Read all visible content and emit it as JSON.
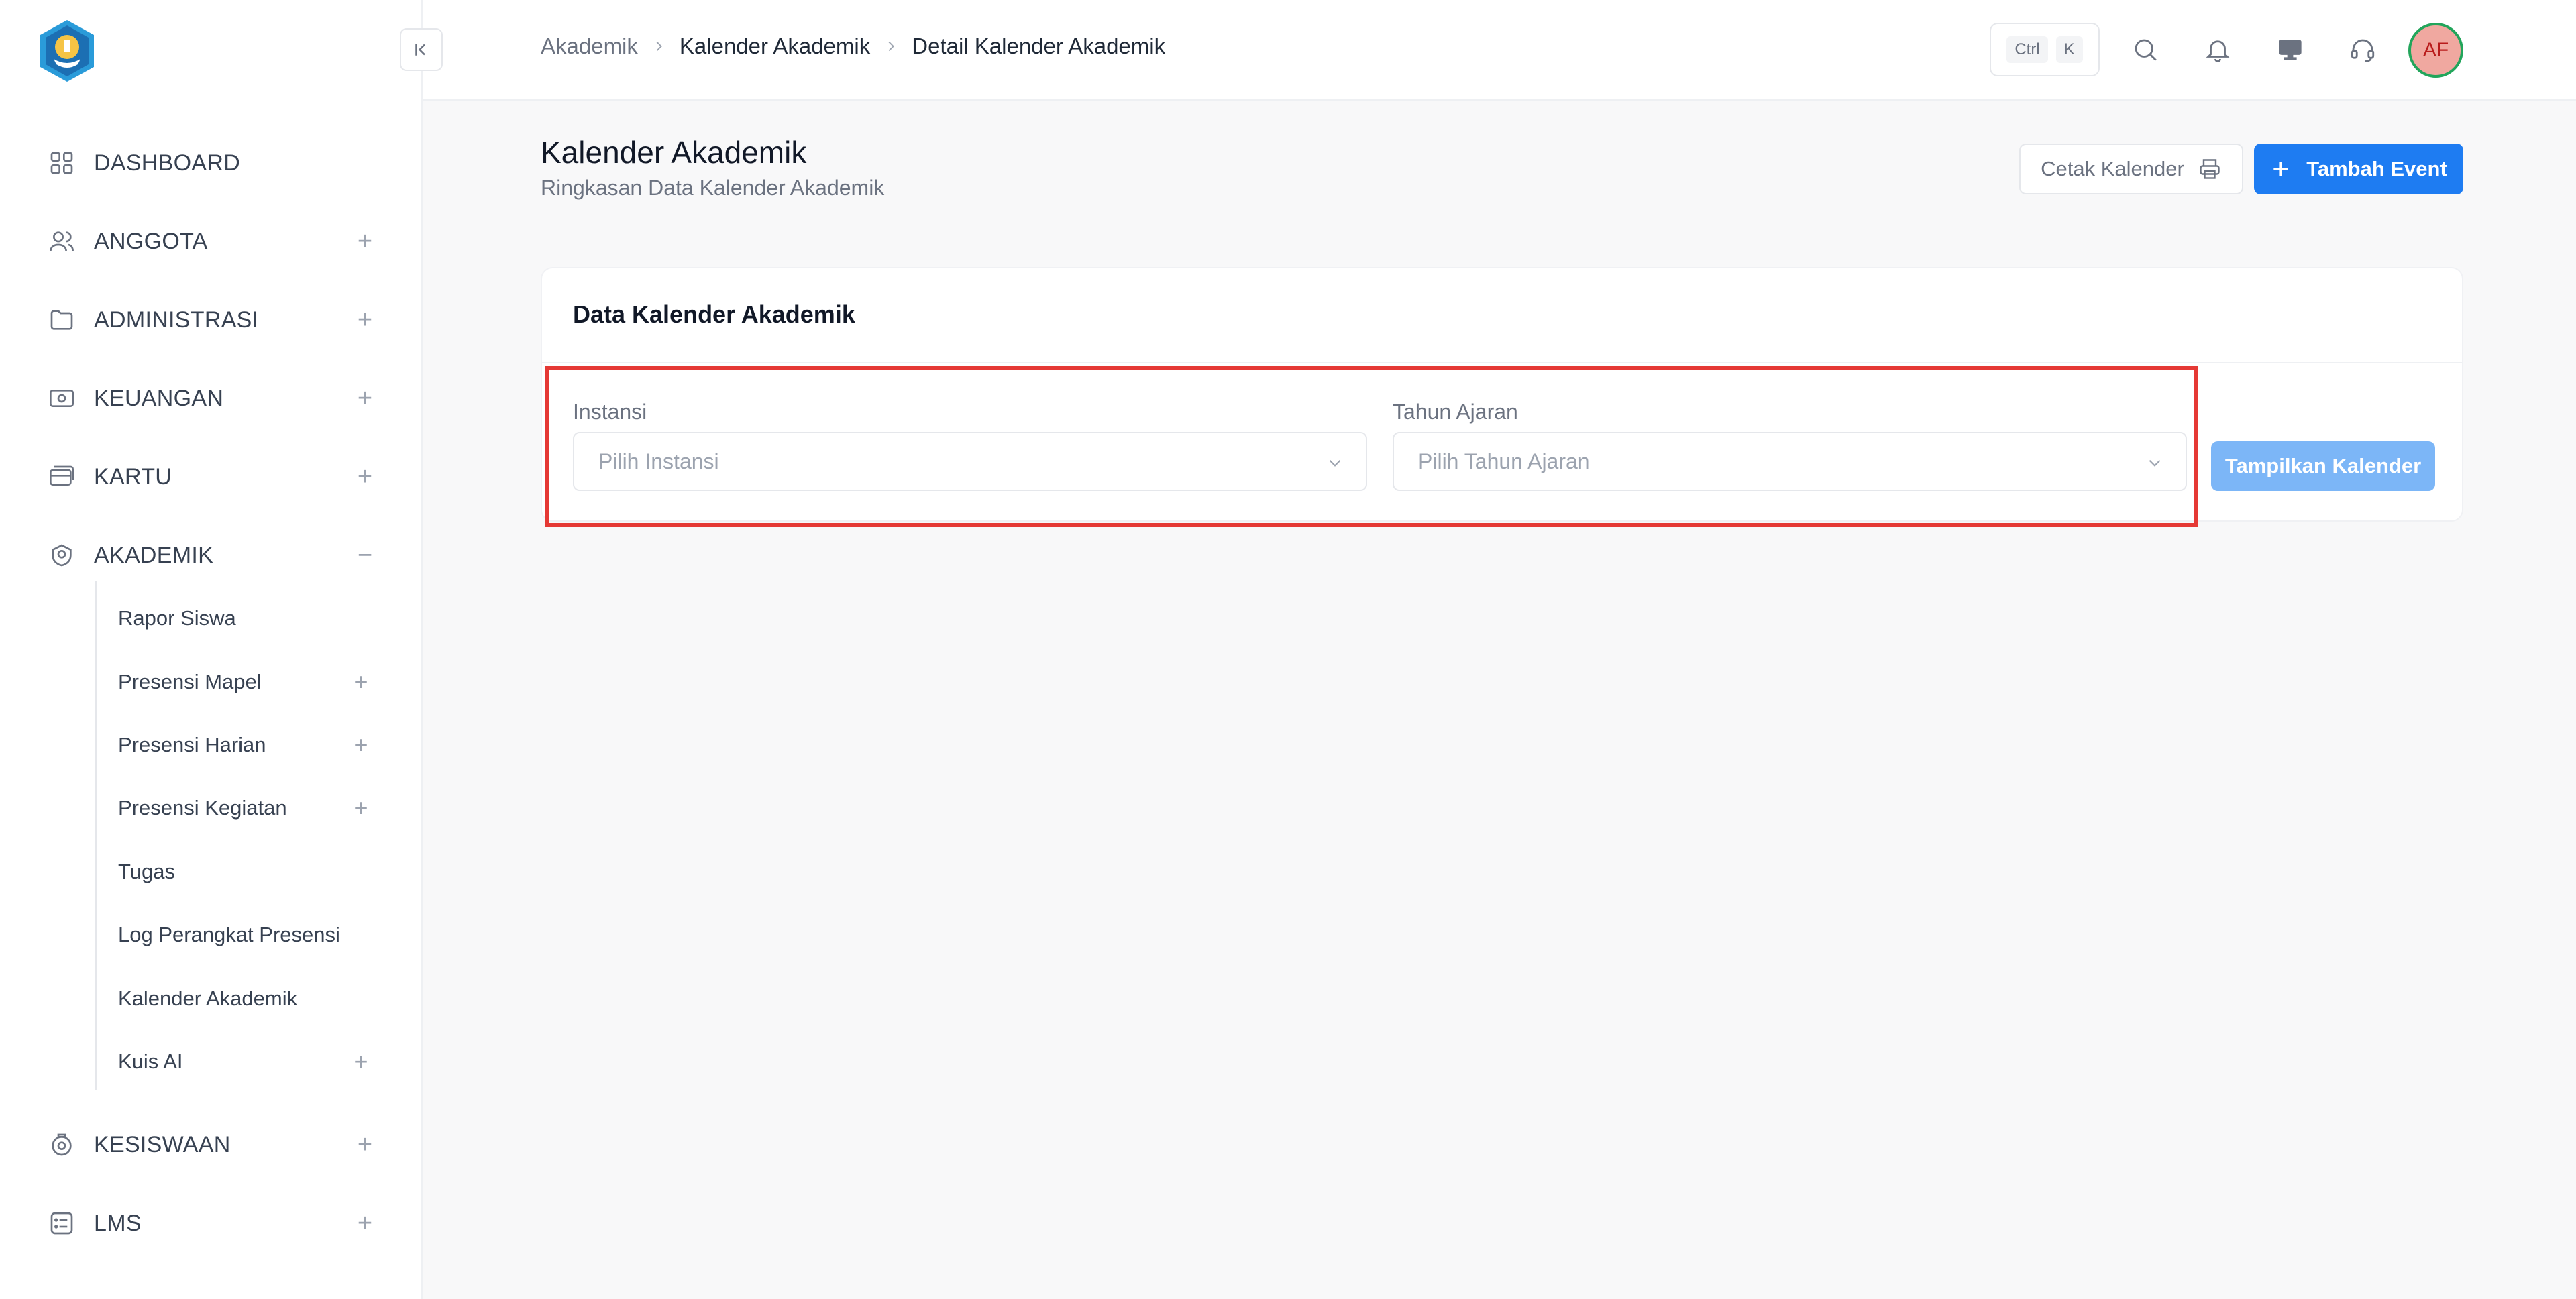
{
  "sidebar": {
    "menu": [
      {
        "label": "DASHBOARD",
        "icon": "grid-icon",
        "toggle": ""
      },
      {
        "label": "ANGGOTA",
        "icon": "users-icon",
        "toggle": "+"
      },
      {
        "label": "ADMINISTRASI",
        "icon": "folder-icon",
        "toggle": "+"
      },
      {
        "label": "KEUANGAN",
        "icon": "money-icon",
        "toggle": "+"
      },
      {
        "label": "KARTU",
        "icon": "card-icon",
        "toggle": "+"
      },
      {
        "label": "AKADEMIK",
        "icon": "academic-icon",
        "toggle": "−"
      },
      {
        "label": "KESISWAAN",
        "icon": "student-icon",
        "toggle": "+"
      },
      {
        "label": "LMS",
        "icon": "list-icon",
        "toggle": "+"
      }
    ],
    "submenu": [
      {
        "label": "Rapor Siswa",
        "toggle": ""
      },
      {
        "label": "Presensi Mapel",
        "toggle": "+"
      },
      {
        "label": "Presensi Harian",
        "toggle": "+"
      },
      {
        "label": "Presensi Kegiatan",
        "toggle": "+"
      },
      {
        "label": "Tugas",
        "toggle": ""
      },
      {
        "label": "Log Perangkat Presensi",
        "toggle": ""
      },
      {
        "label": "Kalender Akademik",
        "toggle": ""
      },
      {
        "label": "Kuis AI",
        "toggle": "+"
      }
    ]
  },
  "header": {
    "breadcrumb": [
      "Akademik",
      "Kalender Akademik",
      "Detail Kalender Akademik"
    ],
    "shortcut": [
      "Ctrl",
      "K"
    ],
    "avatar_initials": "AF"
  },
  "page": {
    "title": "Kalender Akademik",
    "subtitle": "Ringkasan Data Kalender Akademik",
    "print_label": "Cetak Kalender",
    "add_label": "Tambah Event"
  },
  "card": {
    "title": "Data Kalender Akademik",
    "instansi_label": "Instansi",
    "instansi_placeholder": "Pilih Instansi",
    "tahun_label": "Tahun Ajaran",
    "tahun_placeholder": "Pilih Tahun Ajaran",
    "submit_label": "Tampilkan Kalender"
  },
  "colors": {
    "primary": "#1e7cf2",
    "primary_disabled": "#7cb6f7",
    "highlight": "#e53935",
    "avatar_ring": "#22a55b"
  }
}
